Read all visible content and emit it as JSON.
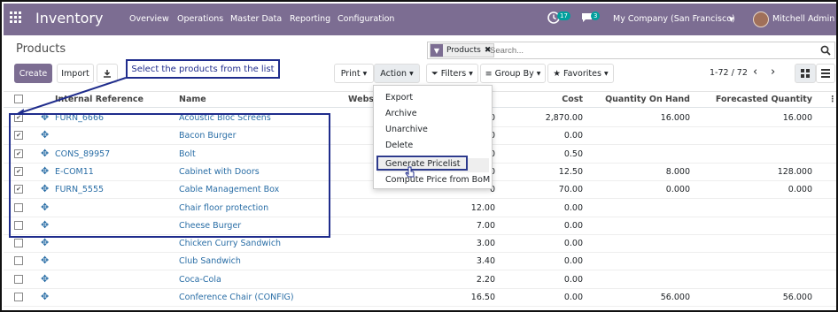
{
  "navbar": {
    "brand": "Inventory",
    "menus": [
      "Overview",
      "Operations",
      "Master Data",
      "Reporting",
      "Configuration"
    ],
    "activity_count": "17",
    "message_count": "3",
    "company": "My Company (San Francisco)",
    "user": "Mitchell Admin"
  },
  "control_panel": {
    "title": "Products",
    "create": "Create",
    "import": "Import",
    "print": "Print",
    "action": "Action",
    "filters": "Filters",
    "group_by": "Group By",
    "favorites": "Favorites",
    "pager": "1-72 / 72",
    "search_placeholder": "Search...",
    "facet": "Products"
  },
  "action_menu": [
    "Export",
    "Archive",
    "Unarchive",
    "Delete",
    "Generate Pricelist",
    "Compute Price from BoM"
  ],
  "callout_text": "Select the products from the list",
  "table": {
    "headers": {
      "ref": "Internal Reference",
      "name": "Name",
      "website": "Websi",
      "cost": "Cost",
      "qoh": "Quantity On Hand",
      "forecast": "Forecasted Quantity"
    },
    "rows": [
      {
        "checked": true,
        "ref": "FURN_6666",
        "name": "Acoustic Bloc Screens",
        "price": "0",
        "cost": "2,870.00",
        "qoh": "16.000",
        "forecast": "16.000"
      },
      {
        "checked": true,
        "ref": "",
        "name": "Bacon Burger",
        "price": "0",
        "cost": "0.00",
        "qoh": "",
        "forecast": ""
      },
      {
        "checked": true,
        "ref": "CONS_89957",
        "name": "Bolt",
        "price": "0",
        "cost": "0.50",
        "qoh": "",
        "forecast": ""
      },
      {
        "checked": true,
        "ref": "E-COM11",
        "name": "Cabinet with Doors",
        "price": "0",
        "cost": "12.50",
        "qoh": "8.000",
        "forecast": "128.000"
      },
      {
        "checked": true,
        "ref": "FURN_5555",
        "name": "Cable Management Box",
        "price": "0",
        "cost": "70.00",
        "qoh": "0.000",
        "forecast": "0.000"
      },
      {
        "checked": false,
        "ref": "",
        "name": "Chair floor protection",
        "price": "12.00",
        "cost": "0.00",
        "qoh": "",
        "forecast": ""
      },
      {
        "checked": false,
        "ref": "",
        "name": "Cheese Burger",
        "price": "7.00",
        "cost": "0.00",
        "qoh": "",
        "forecast": ""
      },
      {
        "checked": false,
        "ref": "",
        "name": "Chicken Curry Sandwich",
        "price": "3.00",
        "cost": "0.00",
        "qoh": "",
        "forecast": ""
      },
      {
        "checked": false,
        "ref": "",
        "name": "Club Sandwich",
        "price": "3.40",
        "cost": "0.00",
        "qoh": "",
        "forecast": ""
      },
      {
        "checked": false,
        "ref": "",
        "name": "Coca-Cola",
        "price": "2.20",
        "cost": "0.00",
        "qoh": "",
        "forecast": ""
      },
      {
        "checked": false,
        "ref": "",
        "name": "Conference Chair (CONFIG)",
        "price": "16.50",
        "cost": "0.00",
        "qoh": "56.000",
        "forecast": "56.000"
      }
    ]
  }
}
